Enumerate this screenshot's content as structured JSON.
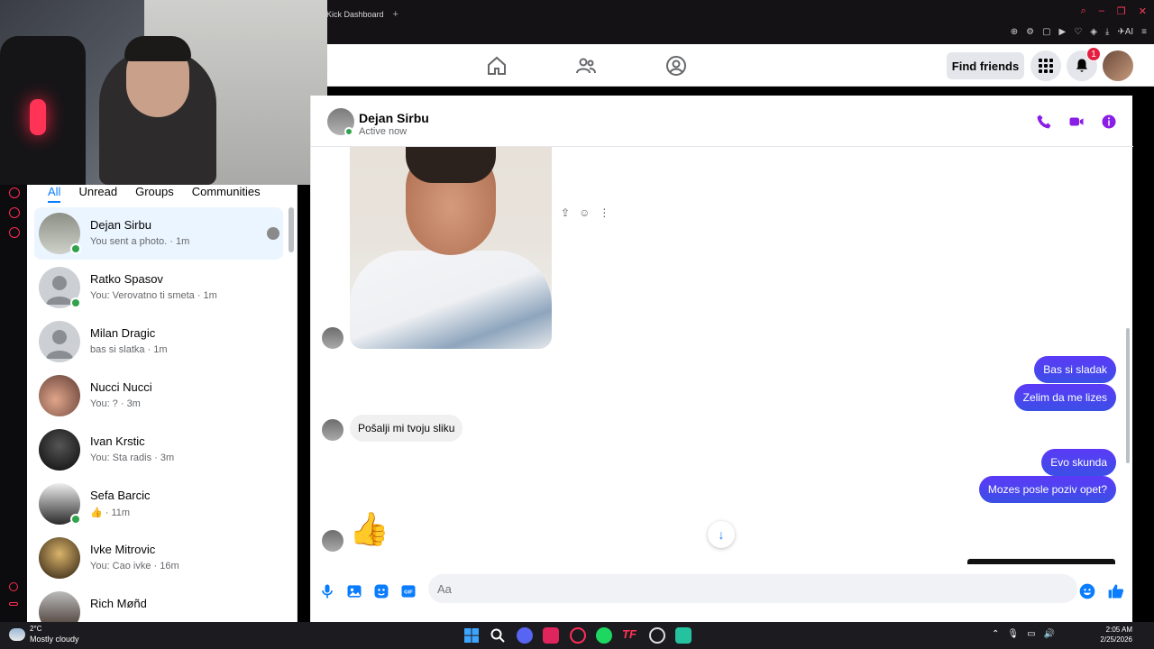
{
  "browser": {
    "tab_title": "Kick Dashboard",
    "new_tab": "+"
  },
  "header": {
    "find_friends": "Find friends",
    "notification_count": "1"
  },
  "chat_list": {
    "filters": [
      "All",
      "Unread",
      "Groups",
      "Communities"
    ],
    "items": [
      {
        "name": "Dejan Sirbu",
        "preview": "You sent a photo. · 1m"
      },
      {
        "name": "Ratko Spasov",
        "preview": "You: Verovatno ti smeta · 1m"
      },
      {
        "name": "Milan Dragic",
        "preview": "bas si slatka · 1m"
      },
      {
        "name": "Nucci Nucci",
        "preview": "You: ? · 3m"
      },
      {
        "name": "Ivan Krstic",
        "preview": "You: Sta radis · 3m"
      },
      {
        "name": "Sefa Barcic",
        "preview": "· 11m"
      },
      {
        "name": "Ivke Mitrovic",
        "preview": "You: Cao ivke · 16m"
      },
      {
        "name": "Rich Møñd",
        "preview": ""
      }
    ]
  },
  "conversation": {
    "name": "Dejan Sirbu",
    "status": "Active now",
    "messages": {
      "out1": "Bas si sladak",
      "out2": "Zelim da me lizes",
      "in1": "Pošalji mi tvoju sliku",
      "out3": "Evo skunda",
      "out4": "Mozes posle poziv opet?"
    },
    "like_emoji": "👍",
    "composer_placeholder": "Aa"
  },
  "taskbar": {
    "weather_temp": "2°C",
    "weather_desc": "Mostly cloudy",
    "time": "2:05 AM",
    "date": "2/25/2026"
  },
  "colors": {
    "accent": "#0a7cff",
    "messenger_purple": "#8a1de6",
    "bubble_out": "#4b44ef",
    "online": "#31a24c",
    "gx_red": "#ff2d55"
  }
}
